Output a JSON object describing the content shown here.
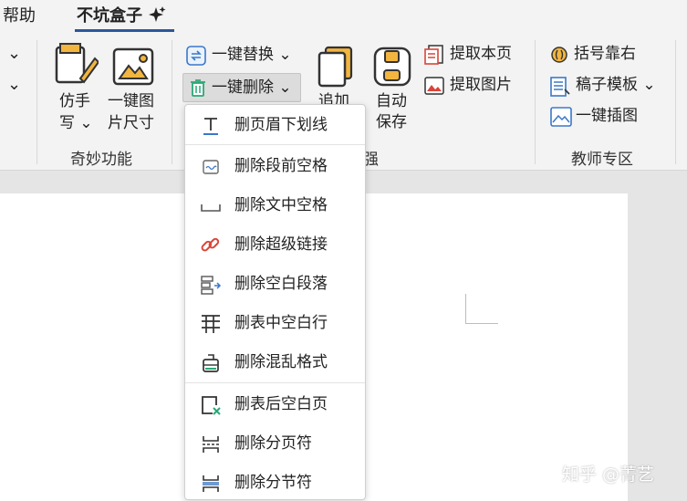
{
  "tabs": [
    {
      "label": "帮助",
      "active": false
    },
    {
      "label": "不坑盒子",
      "active": true
    }
  ],
  "ribbon": {
    "left_chevrons": [
      "⌄",
      "⌄"
    ],
    "group_qimiao": {
      "name": "奇妙功能",
      "buttons": [
        {
          "line1": "仿手",
          "line2": "写 ⌄",
          "icon": "handwriting-icon"
        },
        {
          "line1": "一键图",
          "line2": "片尺寸",
          "icon": "image-resize-icon"
        }
      ]
    },
    "group_zengqiang": {
      "name_visible": "强",
      "replace_label": "一键替换 ⌄",
      "delete_label": "一键删除 ⌄",
      "append": {
        "line1": "追加"
      },
      "autosave": {
        "line1": "自动",
        "line2": "保存"
      },
      "extract_page": "提取本页",
      "extract_image": "提取图片"
    },
    "group_teacher": {
      "name": "教师专区",
      "bracket_right": "括号靠右",
      "grid_template": "稿子模板 ⌄",
      "insert_image": "一键插图"
    }
  },
  "delete_menu": {
    "items": [
      {
        "label": "删页眉下划线",
        "icon": "text-underline-icon"
      },
      {
        "label": "删除段前空格",
        "icon": "paragraph-space-icon"
      },
      {
        "label": "删除文中空格",
        "icon": "space-icon"
      },
      {
        "label": "删除超级链接",
        "icon": "link-icon"
      },
      {
        "label": "删除空白段落",
        "icon": "empty-paragraph-icon"
      },
      {
        "label": "删表中空白行",
        "icon": "table-row-icon"
      },
      {
        "label": "删除混乱格式",
        "icon": "eraser-icon"
      },
      {
        "label": "删表后空白页",
        "icon": "blank-page-icon"
      },
      {
        "label": "删除分页符",
        "icon": "page-break-icon"
      },
      {
        "label": "删除分节符",
        "icon": "section-break-icon"
      }
    ]
  },
  "watermark": "知乎 @菁艺",
  "colors": {
    "accent": "#2b579a",
    "icon_orange": "#e8a23a",
    "icon_blue": "#3a78c9",
    "icon_red": "#d9443a",
    "icon_green": "#2aa876"
  }
}
